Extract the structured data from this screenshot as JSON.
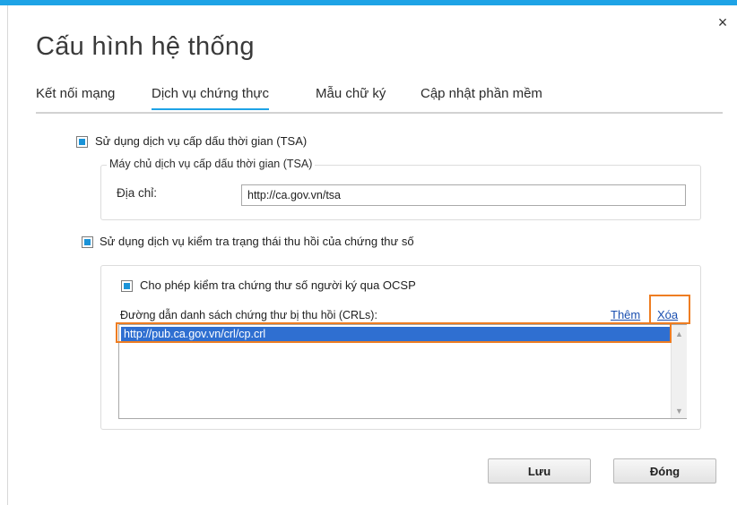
{
  "window": {
    "title": "Cấu hình hệ thống",
    "close_glyph": "×",
    "accent": "#1ea3e6"
  },
  "tabs": [
    {
      "label": "Kết nối mạng"
    },
    {
      "label": "Dịch vụ chứng thực",
      "active": true
    },
    {
      "label": "Mẫu chữ ký"
    },
    {
      "label": "Cập nhật phần mềm"
    }
  ],
  "tsa": {
    "checkbox_label": "Sử dụng dịch vụ cấp dấu thời gian (TSA)",
    "checked": true,
    "group_title": "Máy chủ dịch vụ cấp dấu thời gian (TSA)",
    "address_label": "Địa chỉ:",
    "address_value": "http://ca.gov.vn/tsa"
  },
  "revocation": {
    "checkbox_label": "Sử dụng dịch vụ kiểm tra trạng thái thu hồi của chứng thư số",
    "checked": true,
    "ocsp_label": "Cho phép kiểm tra chứng thư số người ký qua OCSP",
    "ocsp_checked": true,
    "crl_label": "Đường dẫn danh sách chứng thư bị thu hồi (CRLs):",
    "add_link": "Thêm",
    "delete_link": "Xóa",
    "crl_items": [
      "http://pub.ca.gov.vn/crl/cp.crl"
    ]
  },
  "buttons": {
    "save": "Lưu",
    "close": "Đóng"
  },
  "highlight_color": "#ee7d22"
}
